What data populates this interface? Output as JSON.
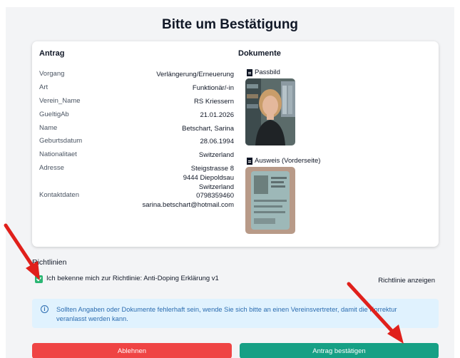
{
  "page": {
    "title": "Bitte um Bestätigung"
  },
  "antrag": {
    "heading": "Antrag",
    "rows": [
      {
        "label": "Vorgang",
        "value": "Verlängerung/Erneuerung"
      },
      {
        "label": "Art",
        "value": "Funktionär/-in"
      },
      {
        "label": "Verein_Name",
        "value": "RS Kriessern"
      },
      {
        "label": "GueltigAb",
        "value": "21.01.2026"
      },
      {
        "label": "Name",
        "value": "Betschart, Sarina"
      },
      {
        "label": "Geburtsdatum",
        "value": "28.06.1994"
      },
      {
        "label": "Nationalitaet",
        "value": "Switzerland"
      },
      {
        "label": "Adresse",
        "value_lines": [
          "Steigstrasse 8",
          "9444 Diepoldsau",
          "Switzerland"
        ]
      },
      {
        "label": "Kontaktdaten",
        "value_lines": [
          "0798359460",
          "sarina.betschart@hotmail.com"
        ]
      }
    ]
  },
  "dokumente": {
    "heading": "Dokumente",
    "items": [
      {
        "label": "Passbild",
        "icon": "document-icon"
      },
      {
        "label": "Ausweis (Vorderseite)",
        "icon": "document-icon"
      }
    ]
  },
  "richtlinien": {
    "heading": "Richtlinien",
    "checkbox_label": "Ich bekenne mich zur Richtlinie: Anti-Doping Erklärung v1",
    "checked": true,
    "link_label": "Richtlinie anzeigen"
  },
  "info": {
    "icon": "info-icon",
    "icon_glyph": "i",
    "text": "Sollten Angaben oder Dokumente fehlerhaft sein, wende Sie sich bitte an einen Vereinsvertreter, damit die Korrektur veranlasst werden kann."
  },
  "buttons": {
    "reject": "Ablehnen",
    "confirm": "Antrag bestätigen"
  },
  "colors": {
    "accent_green": "#16a085",
    "checkbox_green": "#2bb673",
    "reject_red": "#ef4444",
    "arrow_red": "#e0201b",
    "info_bg": "#e0f2fe",
    "info_text": "#2b6cb0"
  }
}
